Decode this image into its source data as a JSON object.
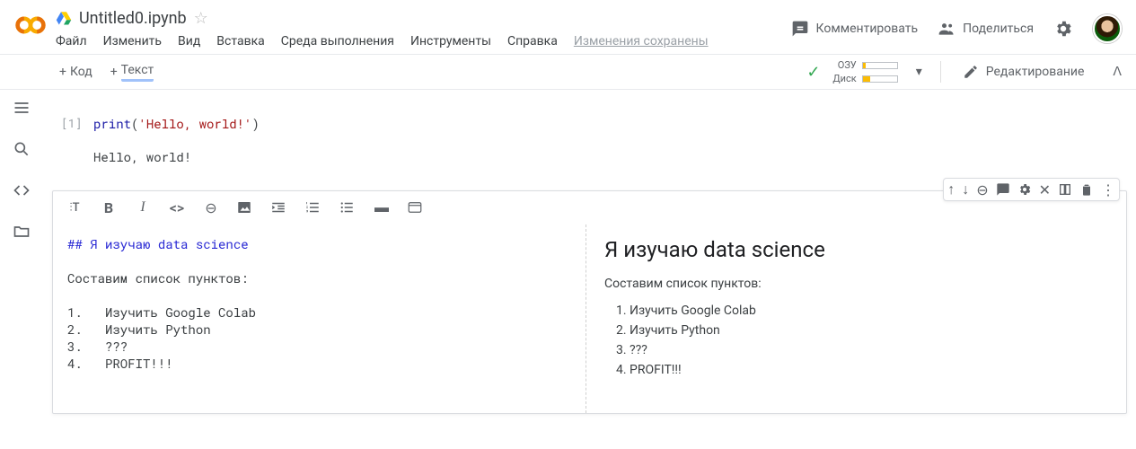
{
  "header": {
    "doc_title": "Untitled0.ipynb",
    "menu": {
      "file": "Файл",
      "edit": "Изменить",
      "view": "Вид",
      "insert": "Вставка",
      "runtime": "Среда выполнения",
      "tools": "Инструменты",
      "help": "Справка"
    },
    "autosave": "Изменения сохранены",
    "comment": "Комментировать",
    "share": "Поделиться"
  },
  "toolbar": {
    "code": "Код",
    "text": "Текст",
    "ram_label": "ОЗУ",
    "disk_label": "Диск",
    "editing": "Редактирование"
  },
  "cell1": {
    "prompt": "[1]",
    "code_fn": "print",
    "code_str": "'Hello, world!'",
    "output": "Hello, world!"
  },
  "md": {
    "src_heading": "## Я изучаю data science",
    "src_para": "Составим список пунктов:",
    "src_items": {
      "i1": "1.   Изучить Google Colab",
      "i2": "2.   Изучить Python",
      "i3": "3.   ???",
      "i4": "4.   PROFIT!!!"
    },
    "render": {
      "heading": "Я изучаю data science",
      "para": "Составим список пунктов:",
      "li1": "Изучить Google Colab",
      "li2": "Изучить Python",
      "li3": "???",
      "li4": "PROFIT!!!"
    }
  }
}
